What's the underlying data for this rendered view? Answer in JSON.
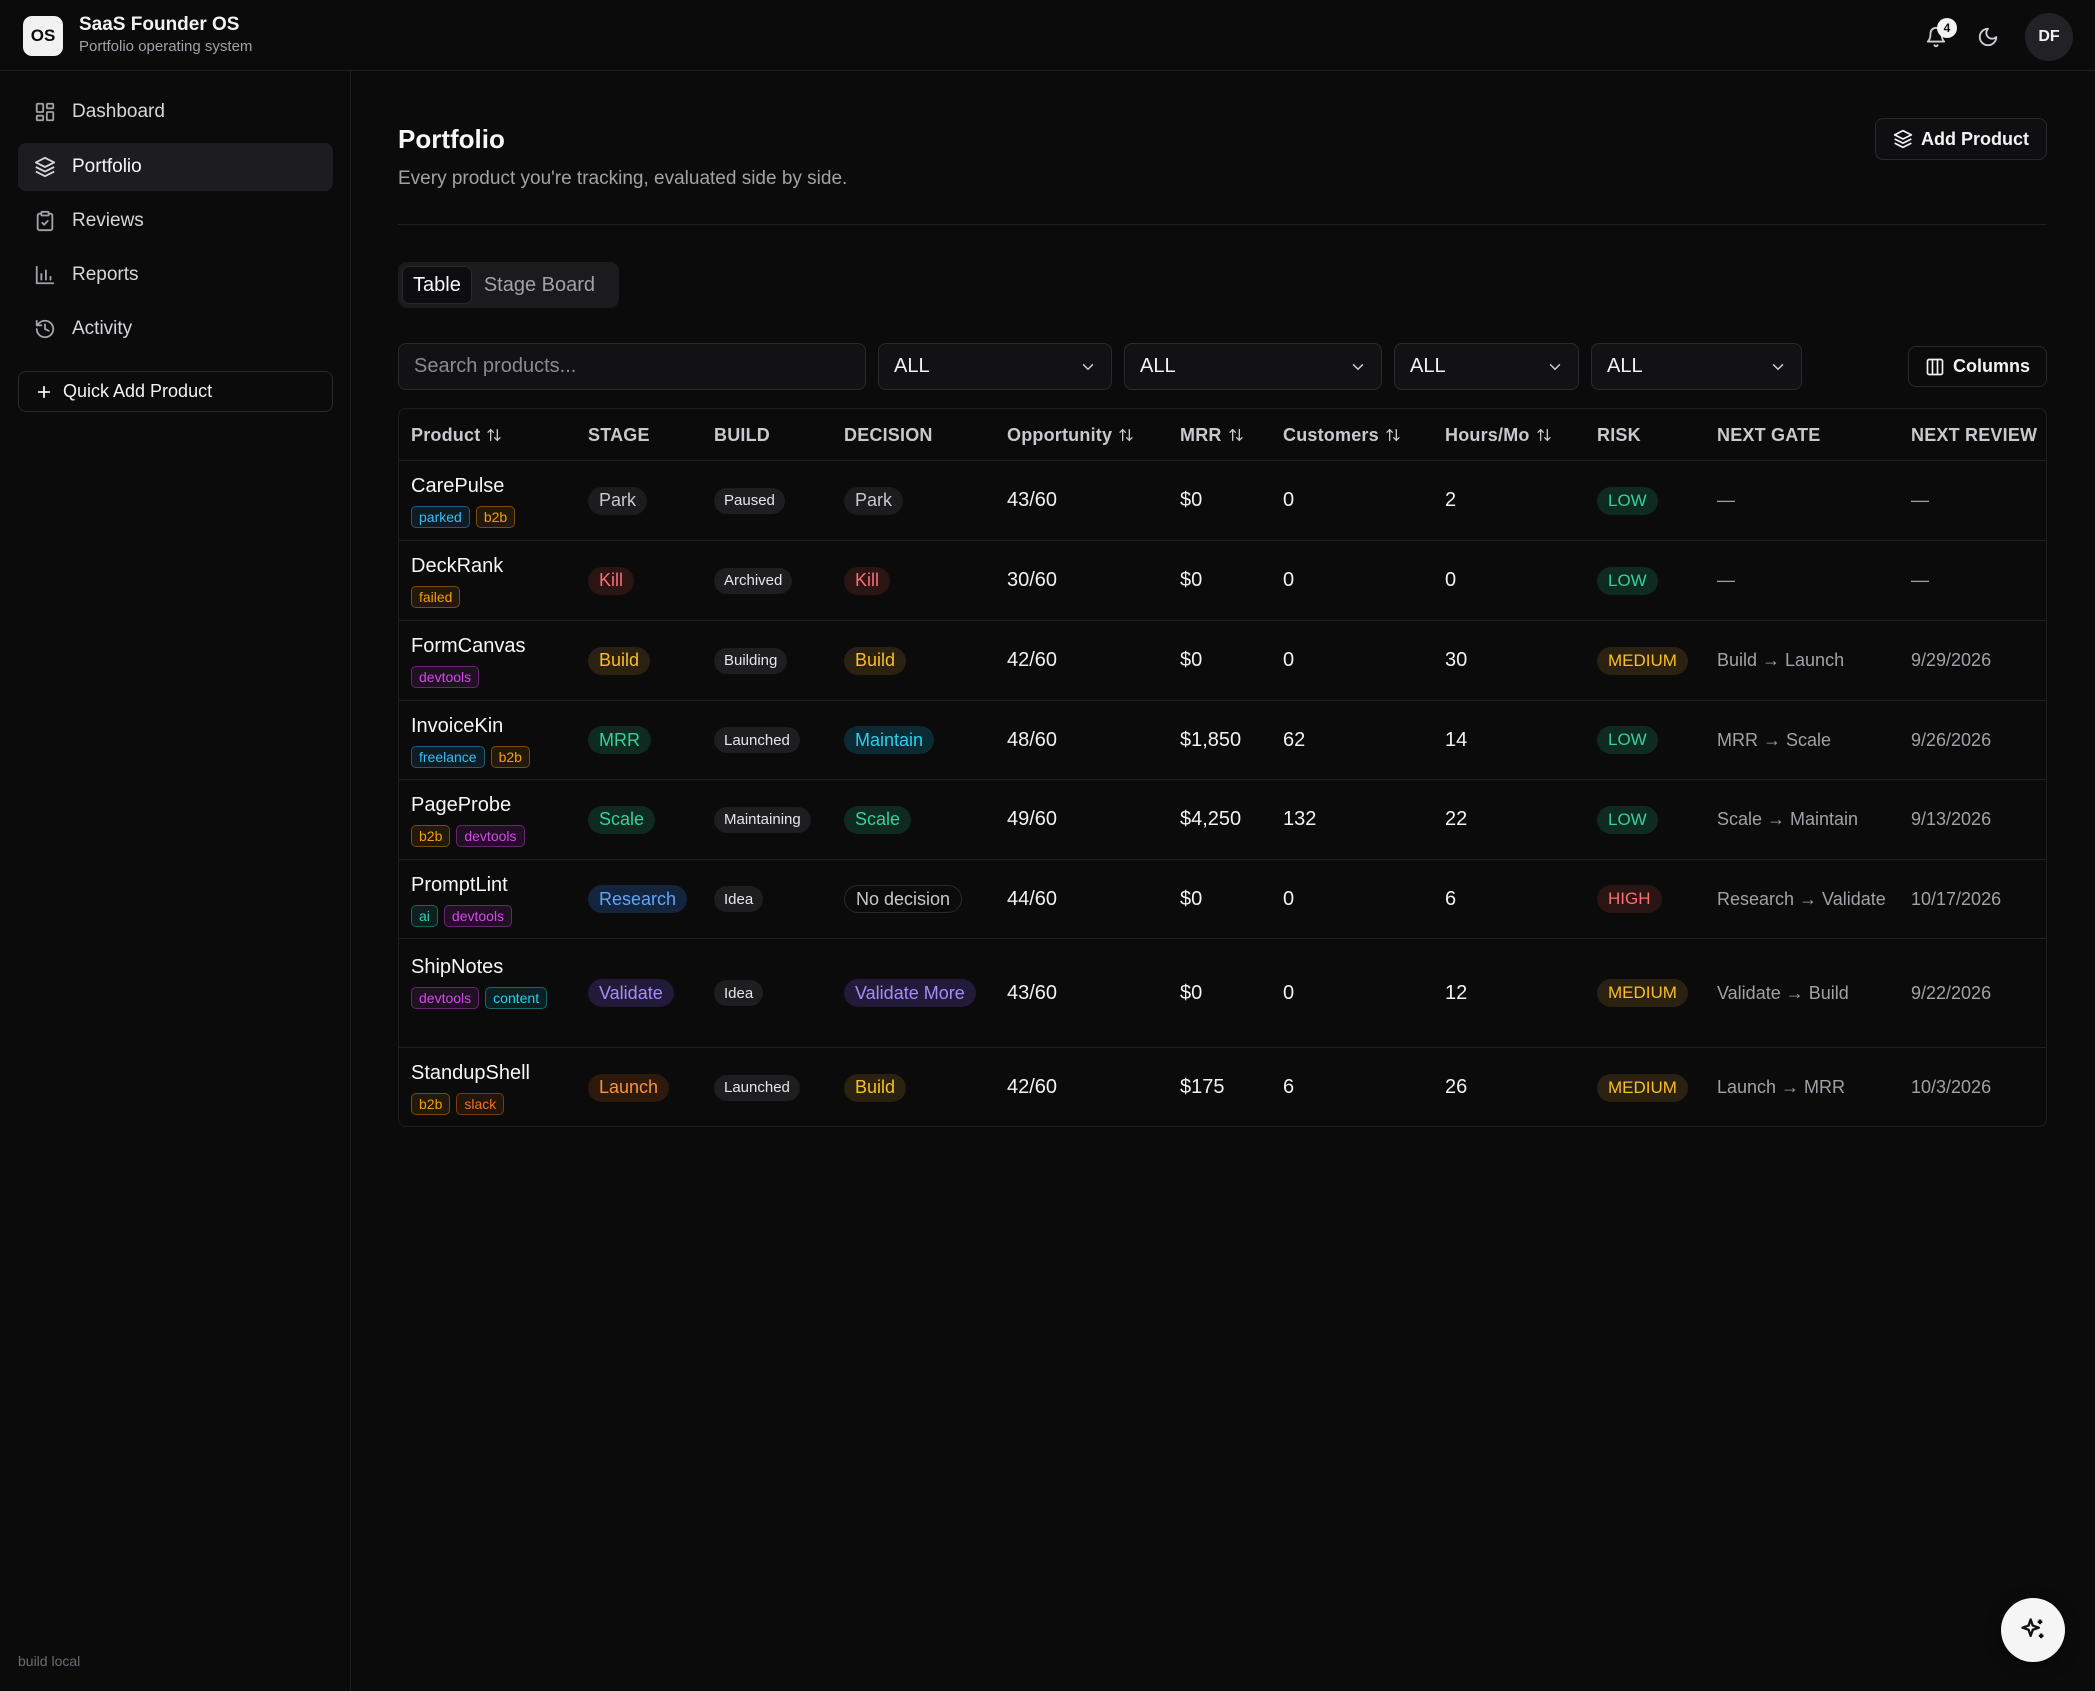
{
  "brand": {
    "logo_text": "OS",
    "title": "SaaS Founder OS",
    "subtitle": "Portfolio operating system"
  },
  "header": {
    "notification_count": "4",
    "avatar_initials": "DF"
  },
  "sidebar": {
    "items": [
      {
        "label": "Dashboard",
        "icon": "dashboard-icon"
      },
      {
        "label": "Portfolio",
        "icon": "layers-icon",
        "active": true
      },
      {
        "label": "Reviews",
        "icon": "clipboard-check-icon"
      },
      {
        "label": "Reports",
        "icon": "bar-chart-icon"
      },
      {
        "label": "Activity",
        "icon": "history-icon"
      }
    ],
    "quick_add_label": "Quick Add Product",
    "build_note": "build local"
  },
  "page": {
    "title": "Portfolio",
    "subtitle": "Every product you're tracking, evaluated side by side.",
    "add_product_label": "Add Product"
  },
  "view_tabs": {
    "table": "Table",
    "stage_board": "Stage Board",
    "active": "Table"
  },
  "filters": {
    "search_placeholder": "Search products...",
    "selects": [
      "ALL",
      "ALL",
      "ALL",
      "ALL"
    ],
    "columns_label": "Columns"
  },
  "table": {
    "headers": {
      "product": "Product",
      "stage": "STAGE",
      "build": "BUILD",
      "decision": "DECISION",
      "opportunity": "Opportunity",
      "mrr": "MRR",
      "customers": "Customers",
      "hours": "Hours/Mo",
      "risk": "RISK",
      "next_gate": "NEXT GATE",
      "next_review": "NEXT REVIEW"
    },
    "rows": [
      {
        "name": "CarePulse",
        "tags": [
          "parked",
          "b2b"
        ],
        "stage": "Park",
        "build": "Paused",
        "decision": "Park",
        "opportunity": "43/60",
        "mrr": "$0",
        "customers": "0",
        "hours": "2",
        "risk": "LOW",
        "next_gate": "—",
        "next_review": "—"
      },
      {
        "name": "DeckRank",
        "tags": [
          "failed"
        ],
        "stage": "Kill",
        "build": "Archived",
        "decision": "Kill",
        "opportunity": "30/60",
        "mrr": "$0",
        "customers": "0",
        "hours": "0",
        "risk": "LOW",
        "next_gate": "—",
        "next_review": "—"
      },
      {
        "name": "FormCanvas",
        "tags": [
          "devtools"
        ],
        "stage": "Build",
        "build": "Building",
        "decision": "Build",
        "opportunity": "42/60",
        "mrr": "$0",
        "customers": "0",
        "hours": "30",
        "risk": "MEDIUM",
        "next_gate": "Build → Launch",
        "next_review": "9/29/2026"
      },
      {
        "name": "InvoiceKin",
        "tags": [
          "freelance",
          "b2b"
        ],
        "stage": "MRR",
        "build": "Launched",
        "decision": "Maintain",
        "opportunity": "48/60",
        "mrr": "$1,850",
        "customers": "62",
        "hours": "14",
        "risk": "LOW",
        "next_gate": "MRR → Scale",
        "next_review": "9/26/2026"
      },
      {
        "name": "PageProbe",
        "tags": [
          "b2b",
          "devtools"
        ],
        "stage": "Scale",
        "build": "Maintaining",
        "decision": "Scale",
        "opportunity": "49/60",
        "mrr": "$4,250",
        "customers": "132",
        "hours": "22",
        "risk": "LOW",
        "next_gate": "Scale → Maintain",
        "next_review": "9/13/2026"
      },
      {
        "name": "PromptLint",
        "tags": [
          "ai",
          "devtools"
        ],
        "stage": "Research",
        "build": "Idea",
        "decision": "No decision",
        "opportunity": "44/60",
        "mrr": "$0",
        "customers": "0",
        "hours": "6",
        "risk": "HIGH",
        "next_gate": "Research → Validate",
        "next_review": "10/17/2026"
      },
      {
        "name": "ShipNotes",
        "tags": [
          "devtools",
          "content"
        ],
        "stage": "Validate",
        "build": "Idea",
        "decision": "Validate More",
        "opportunity": "43/60",
        "mrr": "$0",
        "customers": "0",
        "hours": "12",
        "risk": "MEDIUM",
        "next_gate": "Validate → Build",
        "next_review": "9/22/2026"
      },
      {
        "name": "StandupShell",
        "tags": [
          "b2b",
          "slack"
        ],
        "stage": "Launch",
        "build": "Launched",
        "decision": "Build",
        "opportunity": "42/60",
        "mrr": "$175",
        "customers": "6",
        "hours": "26",
        "risk": "MEDIUM",
        "next_gate": "Launch → MRR",
        "next_review": "10/3/2026"
      }
    ]
  },
  "colors": {
    "tags": {
      "parked": "#38bdf8",
      "b2b": "#f59e0b",
      "failed": "#f59e0b",
      "devtools": "#d946ef",
      "freelance": "#38bdf8",
      "ai": "#2dd4bf",
      "content": "#22d3ee",
      "slack": "#f97316"
    },
    "stages": {
      "Park": [
        "#c8c8ce",
        "#1c1c1f"
      ],
      "Kill": [
        "#f87171",
        "#2a1414"
      ],
      "Build": [
        "#fbbf24",
        "#2b2110"
      ],
      "MRR": [
        "#34d399",
        "#0f2a20"
      ],
      "Scale": [
        "#34d399",
        "#0f2a20"
      ],
      "Research": [
        "#60a5fa",
        "#13243d"
      ],
      "Validate": [
        "#a78bfa",
        "#211a38"
      ],
      "Launch": [
        "#fb923c",
        "#2d1a0c"
      ],
      "Maintain": [
        "#22d3ee",
        "#0c2a33"
      ],
      "No decision": [
        "#c8c8ce",
        "#0b0b0c"
      ],
      "Validate More": [
        "#a78bfa",
        "#211a38"
      ]
    },
    "risk": {
      "LOW": [
        "#34d399",
        "#0f2a20"
      ],
      "MEDIUM": [
        "#fbbf24",
        "#2b2110"
      ],
      "HIGH": [
        "#f87171",
        "#2a1414"
      ]
    }
  }
}
